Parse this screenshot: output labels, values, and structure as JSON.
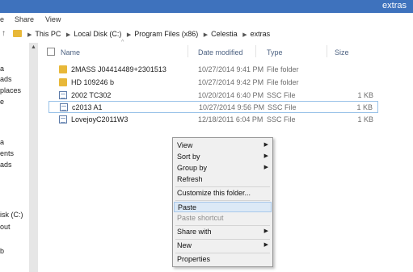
{
  "window": {
    "title": "extras"
  },
  "menu": [
    "e",
    "Share",
    "View"
  ],
  "address": {
    "crumbs": [
      "This PC",
      "Local Disk (C:)",
      "Program Files (x86)",
      "Celestia",
      "extras"
    ]
  },
  "nav": [
    "a",
    "ads",
    "places",
    "e",
    "a",
    "ents",
    "ads",
    "isk (C:)",
    "out",
    "b"
  ],
  "columns": {
    "name": "Name",
    "date": "Date modified",
    "type": "Type",
    "size": "Size"
  },
  "files": [
    {
      "name": "2MASS J04414489+2301513",
      "date": "10/27/2014 9:41 PM",
      "type": "File folder",
      "size": "",
      "kind": "folder"
    },
    {
      "name": "HD 109246 b",
      "date": "10/27/2014 9:42 PM",
      "type": "File folder",
      "size": "",
      "kind": "folder"
    },
    {
      "name": "2002 TC302",
      "date": "10/20/2014 6:40 PM",
      "type": "SSC File",
      "size": "1 KB",
      "kind": "file"
    },
    {
      "name": "c2013 A1",
      "date": "10/27/2014 9:56 PM",
      "type": "SSC File",
      "size": "1 KB",
      "kind": "file"
    },
    {
      "name": "LovejoyC2011W3",
      "date": "12/18/2011 6:04 PM",
      "type": "SSC File",
      "size": "1 KB",
      "kind": "file"
    }
  ],
  "context_menu": {
    "view": "View",
    "sort_by": "Sort by",
    "group_by": "Group by",
    "refresh": "Refresh",
    "customize": "Customize this folder...",
    "paste": "Paste",
    "paste_shortcut": "Paste shortcut",
    "share_with": "Share with",
    "new": "New",
    "properties": "Properties"
  },
  "colors": {
    "titlebar": "#3e72bd",
    "selection_border": "#99c2e8",
    "menu_highlight": "#dce9f6"
  }
}
